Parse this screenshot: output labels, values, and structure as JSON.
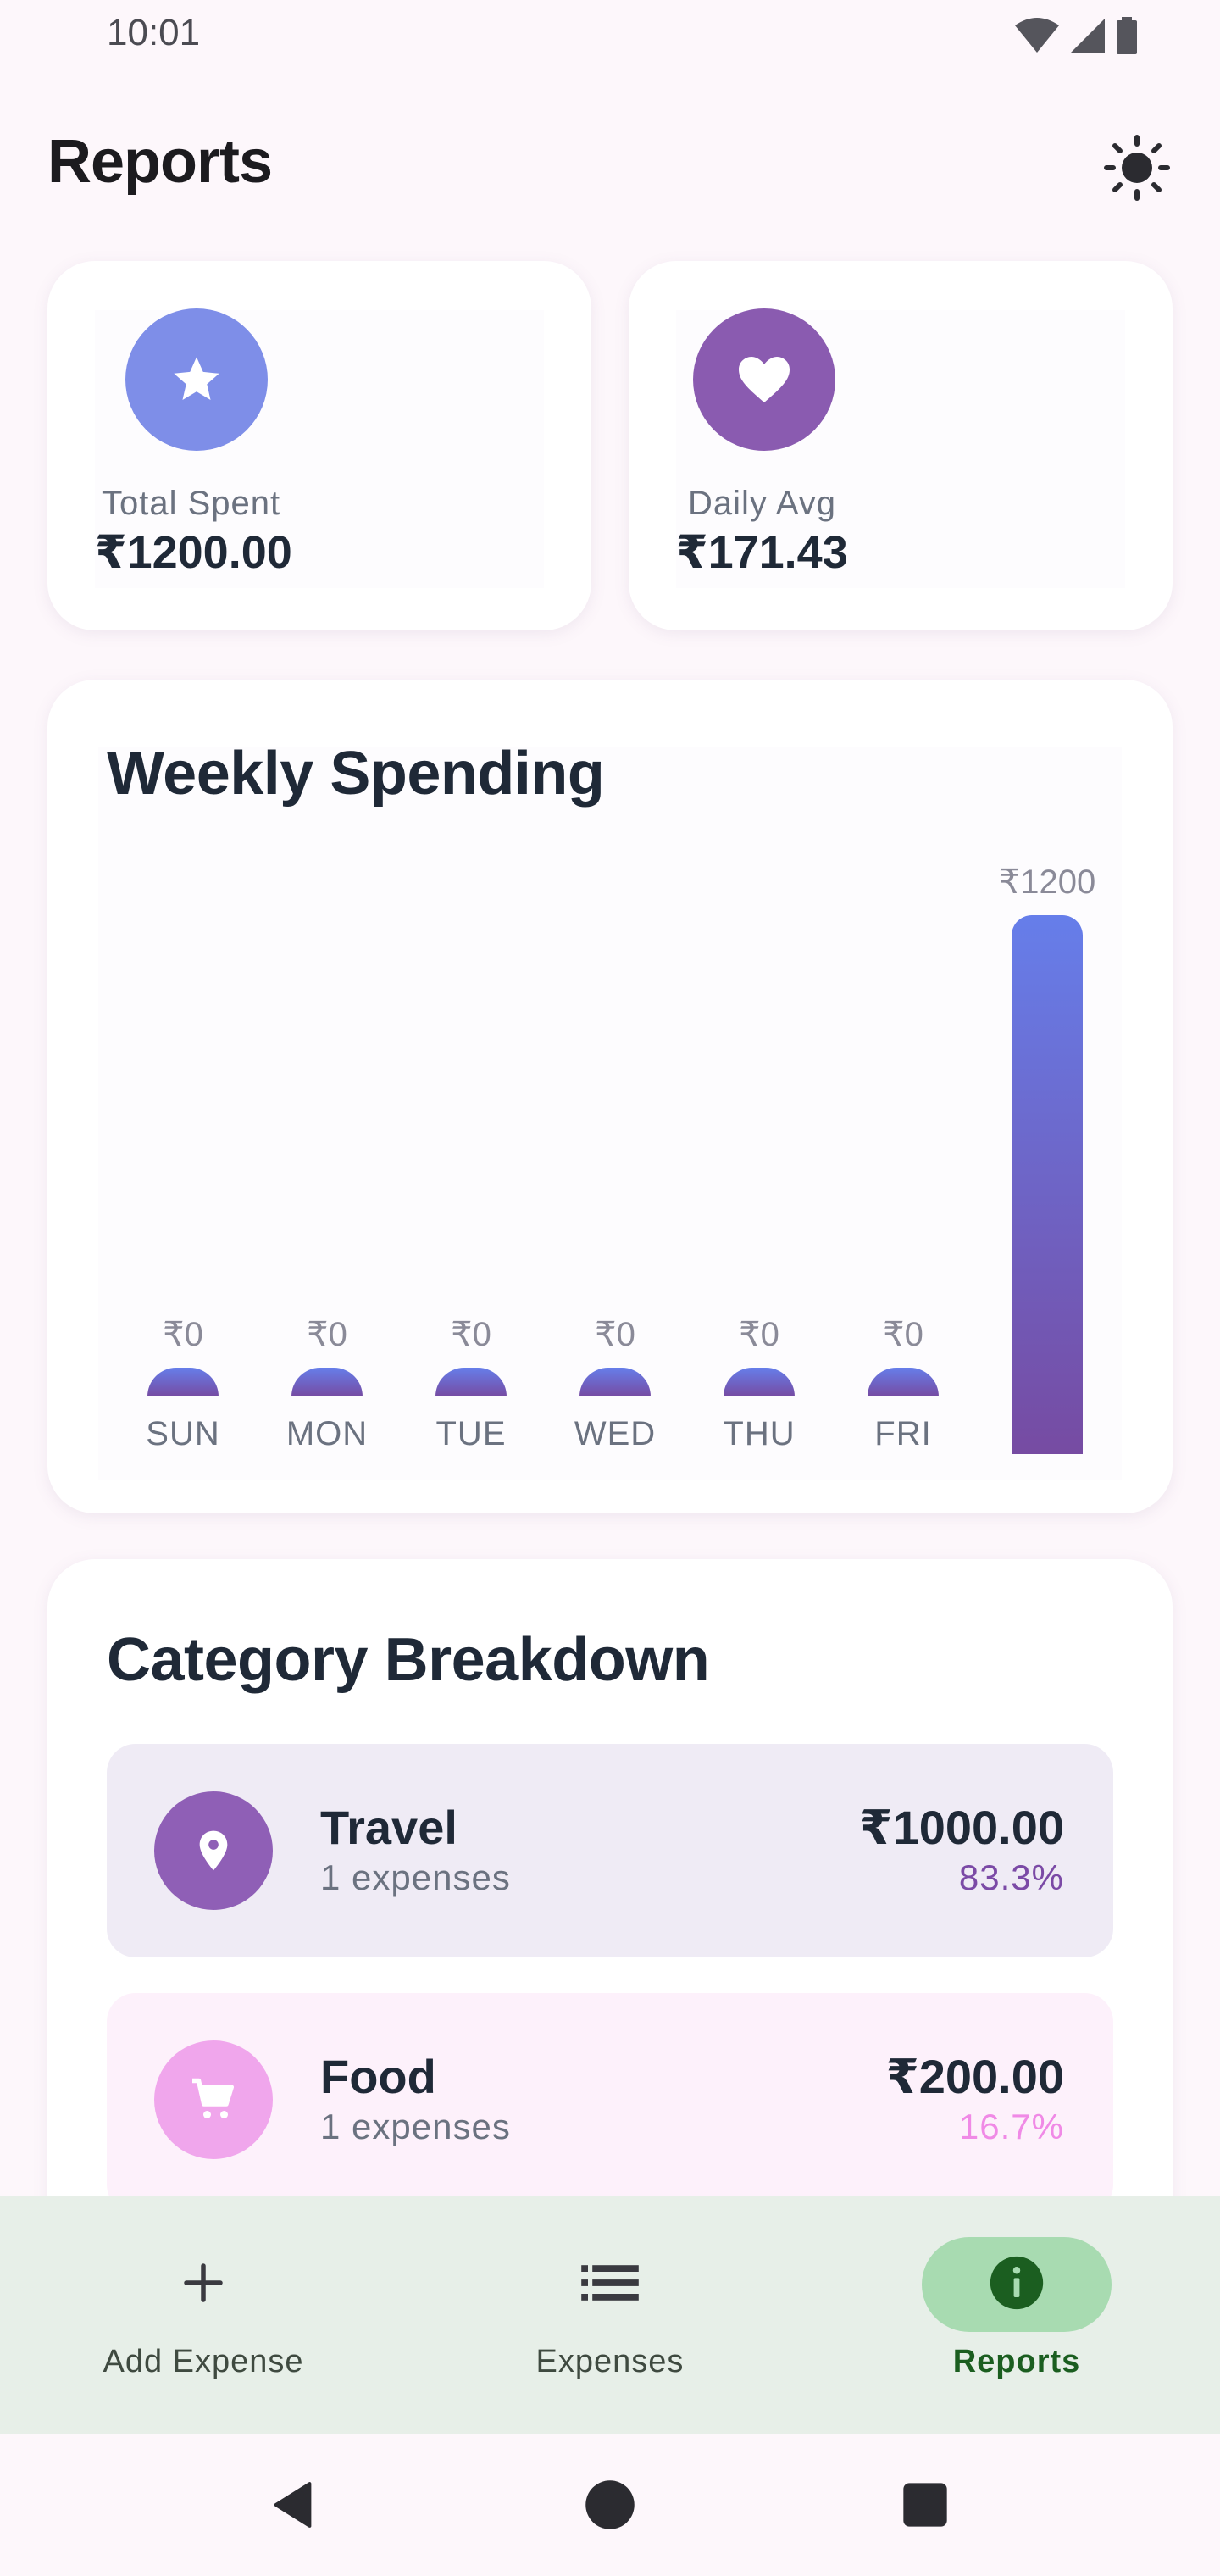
{
  "status_bar": {
    "time": "10:01",
    "icons": [
      "wifi-icon",
      "signal-icon",
      "battery-icon"
    ]
  },
  "header": {
    "title": "Reports",
    "theme_icon": "sun-icon"
  },
  "stats": {
    "total": {
      "label": "Total Spent",
      "value": "₹1200.00",
      "icon": "star-icon",
      "color": "#7e8ee8"
    },
    "daily": {
      "label": "Daily Avg",
      "value": "₹171.43",
      "icon": "heart-icon",
      "color": "#8a5bb0"
    }
  },
  "weekly": {
    "title": "Weekly Spending"
  },
  "chart_data": {
    "type": "bar",
    "categories": [
      "SUN",
      "MON",
      "TUE",
      "WED",
      "THU",
      "FRI",
      ""
    ],
    "values": [
      0,
      0,
      0,
      0,
      0,
      0,
      1200
    ],
    "value_labels": [
      "₹0",
      "₹0",
      "₹0",
      "₹0",
      "₹0",
      "₹0",
      "₹1200"
    ],
    "ylim": [
      0,
      1200
    ],
    "grid": false,
    "bar_gradient": [
      "#667eea",
      "#764ba2"
    ]
  },
  "category": {
    "title": "Category Breakdown",
    "items": [
      {
        "name": "Travel",
        "count": "1 expenses",
        "amount": "₹1000.00",
        "percent": "83.3%",
        "icon": "location-pin-icon",
        "color": "#8f5fb6"
      },
      {
        "name": "Food",
        "count": "1 expenses",
        "amount": "₹200.00",
        "percent": "16.7%",
        "icon": "cart-icon",
        "color": "#f0a6ec"
      }
    ]
  },
  "nav": {
    "items": [
      {
        "label": "Add Expense",
        "icon": "plus-icon"
      },
      {
        "label": "Expenses",
        "icon": "list-icon"
      },
      {
        "label": "Reports",
        "icon": "info-icon",
        "active": true
      }
    ]
  }
}
